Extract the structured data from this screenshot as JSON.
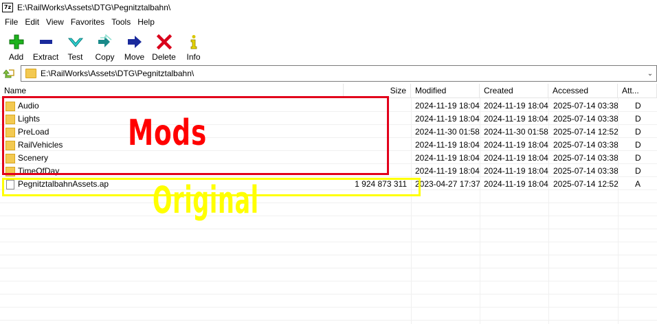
{
  "window": {
    "app_icon_text": "7z",
    "title": "E:\\RailWorks\\Assets\\DTG\\Pegnitztalbahn\\"
  },
  "menu": [
    "File",
    "Edit",
    "View",
    "Favorites",
    "Tools",
    "Help"
  ],
  "toolbar": [
    {
      "label": "Add",
      "icon": "plus-icon",
      "color": "#1db31d"
    },
    {
      "label": "Extract",
      "icon": "minus-icon",
      "color": "#1a2a9c"
    },
    {
      "label": "Test",
      "icon": "check-icon",
      "color": "#18b3b3"
    },
    {
      "label": "Copy",
      "icon": "double-arrow-icon",
      "color": "#1a8a8a"
    },
    {
      "label": "Move",
      "icon": "arrow-right-icon",
      "color": "#1a2a9c"
    },
    {
      "label": "Delete",
      "icon": "x-icon",
      "color": "#d9001b"
    },
    {
      "label": "Info",
      "icon": "info-icon",
      "color": "#d9c700"
    }
  ],
  "address": {
    "path": "E:\\RailWorks\\Assets\\DTG\\Pegnitztalbahn\\"
  },
  "columns": [
    "Name",
    "Size",
    "Modified",
    "Created",
    "Accessed",
    "Att..."
  ],
  "rows": [
    {
      "name": "Audio",
      "size": "",
      "modified": "2024-11-19 18:04",
      "created": "2024-11-19 18:04",
      "accessed": "2025-07-14 03:38",
      "attr": "D",
      "type": "folder"
    },
    {
      "name": "Lights",
      "size": "",
      "modified": "2024-11-19 18:04",
      "created": "2024-11-19 18:04",
      "accessed": "2025-07-14 03:38",
      "attr": "D",
      "type": "folder"
    },
    {
      "name": "PreLoad",
      "size": "",
      "modified": "2024-11-30 01:58",
      "created": "2024-11-30 01:58",
      "accessed": "2025-07-14 12:52",
      "attr": "D",
      "type": "folder"
    },
    {
      "name": "RailVehicles",
      "size": "",
      "modified": "2024-11-19 18:04",
      "created": "2024-11-19 18:04",
      "accessed": "2025-07-14 03:38",
      "attr": "D",
      "type": "folder"
    },
    {
      "name": "Scenery",
      "size": "",
      "modified": "2024-11-19 18:04",
      "created": "2024-11-19 18:04",
      "accessed": "2025-07-14 03:38",
      "attr": "D",
      "type": "folder"
    },
    {
      "name": "TimeOfDay",
      "size": "",
      "modified": "2024-11-19 18:04",
      "created": "2024-11-19 18:04",
      "accessed": "2025-07-14 03:38",
      "attr": "D",
      "type": "folder"
    },
    {
      "name": "PegnitztalbahnAssets.ap",
      "size": "1 924 873 311",
      "modified": "2023-04-27 17:37",
      "created": "2024-11-19 18:04",
      "accessed": "2025-07-14 12:52",
      "attr": "A",
      "type": "file"
    }
  ],
  "annotations": {
    "mods_label": "Mods",
    "mods_color": "#ff0000",
    "original_label": "Original",
    "original_color": "#ffff00"
  }
}
